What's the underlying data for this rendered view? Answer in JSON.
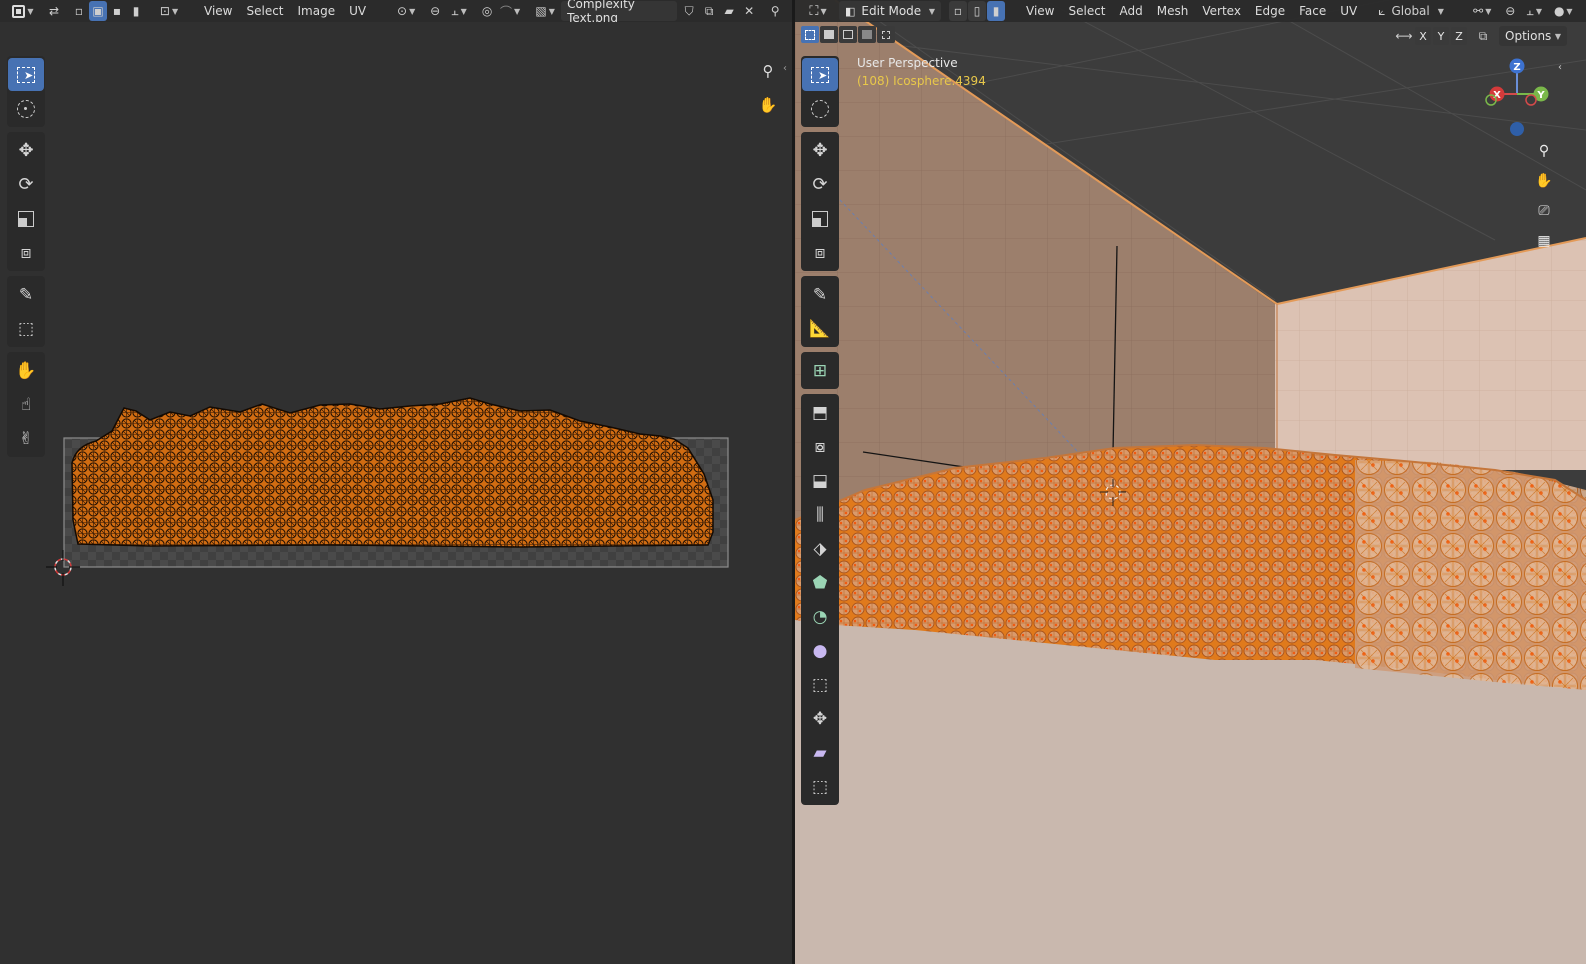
{
  "uv_editor": {
    "menus": [
      "View",
      "Select",
      "Image",
      "UV"
    ],
    "image_name": "Complexity Text.png"
  },
  "viewport": {
    "mode": "Edit Mode",
    "menus": [
      "View",
      "Select",
      "Add",
      "Mesh",
      "Vertex",
      "Edge",
      "Face",
      "UV"
    ],
    "transform_orientation": "Global",
    "axis_x": "X",
    "axis_y": "Y",
    "axis_z": "Z",
    "options_label": "Options",
    "perspective_label": "User Perspective",
    "object_label": "(108) Icosphere.4394"
  },
  "colors": {
    "accent": "#4772b3",
    "uv_orange": "#e07818",
    "mesh_orange": "#e8801a",
    "wall": "#9b7d6a",
    "floor": "#c9b8ae",
    "object_label": "#e8c84a"
  },
  "gizmo": {
    "x": "X",
    "y": "Y",
    "z": "Z"
  }
}
